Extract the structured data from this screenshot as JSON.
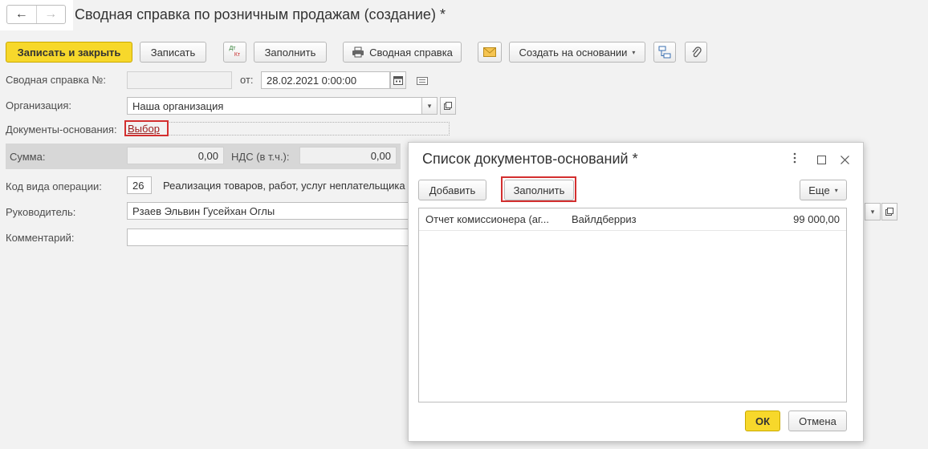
{
  "window": {
    "title": "Сводная справка по розничным продажам (создание) *"
  },
  "nav": {
    "back": "←",
    "forward": "→"
  },
  "toolbar": {
    "save_close": "Записать и закрыть",
    "save": "Записать",
    "dtkt_top": "Дт",
    "dtkt_bottom": "Кт",
    "fill": "Заполнить",
    "summary_report": "Сводная справка",
    "create_based_on": "Создать на основании",
    "dropdown_arrow": "▾"
  },
  "form": {
    "number_label": "Сводная справка №:",
    "number_value": "",
    "date_label": "от:",
    "date_value": "28.02.2021  0:00:00",
    "org_label": "Организация:",
    "org_value": "Наша организация",
    "docs_label": "Документы-основания:",
    "docs_link": "Выбор",
    "sum_label": "Сумма:",
    "sum_value": "0,00",
    "vat_label": "НДС (в т.ч.):",
    "vat_value": "0,00",
    "op_code_label": "Код вида операции:",
    "op_code_value": "26",
    "op_code_desc": "Реализация товаров, работ, услуг неплательщика",
    "manager_label": "Руководитель:",
    "manager_value": "Рзаев Эльвин Гусейхан Оглы",
    "comment_label": "Комментарий:",
    "comment_value": ""
  },
  "modal": {
    "title": "Список документов-оснований *",
    "add_button": "Добавить",
    "fill_button": "Заполнить",
    "more_button": "Еще",
    "rows": [
      {
        "document": "Отчет комиссионера (аг...",
        "counterparty": "Вайлдберриз",
        "amount": "99 000,00"
      }
    ],
    "ok_button": "ОК",
    "cancel_button": "Отмена"
  },
  "colors": {
    "primary_button": "#f7d82b",
    "highlight": "#d32f2f",
    "link": "#9b1b1b"
  }
}
